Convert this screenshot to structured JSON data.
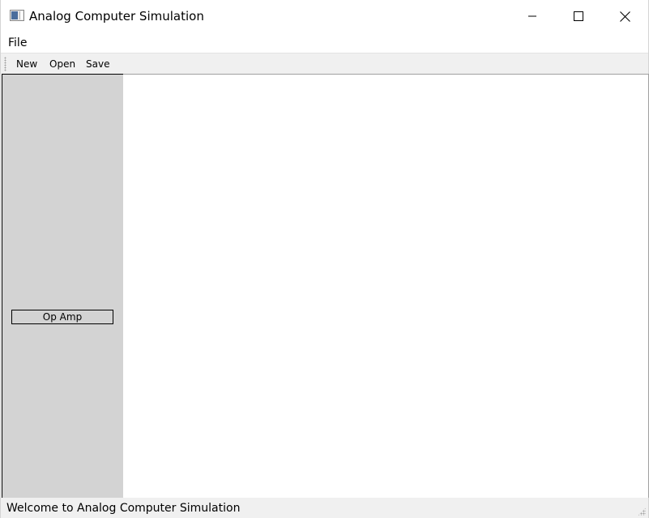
{
  "window": {
    "title": "Analog Computer Simulation",
    "icon": "app-window-icon",
    "controls": [
      "minimize-icon",
      "maximize-icon",
      "close-icon"
    ]
  },
  "menubar": {
    "items": [
      {
        "label": "File"
      }
    ]
  },
  "toolbar": {
    "buttons": [
      {
        "label": "New"
      },
      {
        "label": "Open"
      },
      {
        "label": "Save"
      }
    ]
  },
  "palette": {
    "background": "#d3d3d3",
    "components": [
      {
        "label": "Op Amp"
      }
    ]
  },
  "statusbar": {
    "message": "Welcome to Analog Computer Simulation"
  }
}
